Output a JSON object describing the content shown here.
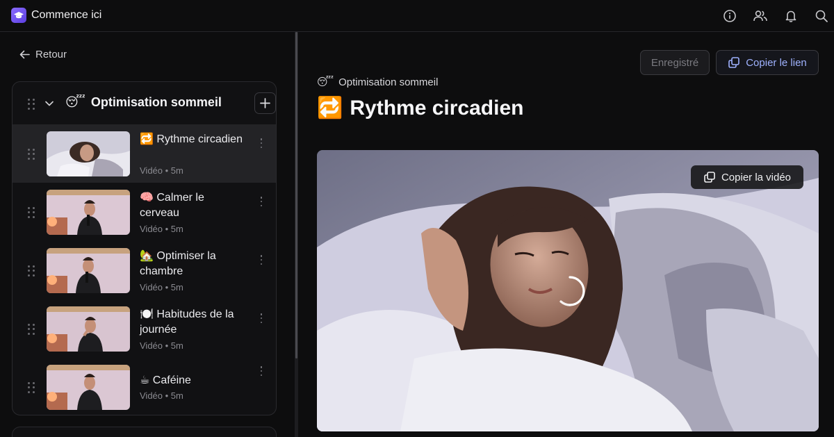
{
  "app": {
    "title": "Commence ici"
  },
  "topbar": {
    "icons": [
      "info-icon",
      "users-icon",
      "bell-icon",
      "search-icon"
    ]
  },
  "sidebar": {
    "back_label": "Retour",
    "module": {
      "emoji": "😴",
      "title": "Optimisation sommeil",
      "lessons": [
        {
          "emoji": "🔁",
          "title": "Rythme circadien",
          "meta": "Vidéo • 5m",
          "active": true
        },
        {
          "emoji": "🧠",
          "title": "Calmer le cerveau",
          "meta": "Vidéo • 5m",
          "active": false
        },
        {
          "emoji": "🏡",
          "title": "Optimiser la chambre",
          "meta": "Vidéo • 5m",
          "active": false
        },
        {
          "emoji": "🍽️",
          "title": "Habitudes de la journée",
          "meta": "Vidéo • 5m",
          "active": false
        },
        {
          "emoji": "☕",
          "title": "Caféine",
          "meta": "Vidéo • 5m",
          "active": false
        }
      ]
    }
  },
  "main": {
    "saved_label": "Enregistré",
    "copy_link_label": "Copier le lien",
    "breadcrumb": {
      "emoji": "😴",
      "label": "Optimisation sommeil"
    },
    "title": {
      "emoji": "🔁",
      "label": "Rythme circadien"
    },
    "video": {
      "copy_label": "Copier la vidéo",
      "state": "loading"
    }
  },
  "colors": {
    "accent": "#9fb2ff",
    "brand": "#7b5cf0",
    "active_row": "#232326"
  }
}
